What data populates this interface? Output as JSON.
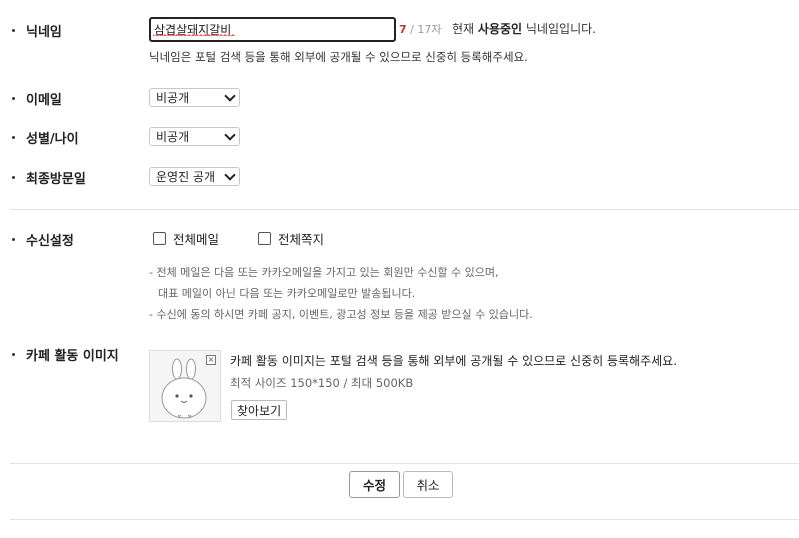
{
  "labels": {
    "nickname": "닉네임",
    "email": "이메일",
    "gender_age": "성별/나이",
    "last_visit": "최종방문일",
    "receive": "수신설정",
    "cafe_image": "카페 활동 이미지"
  },
  "nickname": {
    "value": "삼겹살돼지갈비",
    "count_current": "7",
    "count_max": "/ 17자",
    "current_prefix": "현재",
    "current_bold": "사용중인",
    "current_suffix": "닉네임입니다.",
    "help": "닉네임은 포털 검색 등을 통해 외부에 공개될 수 있으므로 신중히 등록해주세요."
  },
  "email": {
    "selected": "비공개"
  },
  "gender_age": {
    "selected": "비공개"
  },
  "last_visit": {
    "selected": "운영진 공개"
  },
  "receive": {
    "mail_label": "전체메일",
    "mail_checked": false,
    "note_label": "전체쪽지",
    "note_checked": false,
    "notes": [
      "- 전체 메일은 다음 또는 카카오메일을 가지고 있는 회원만 수신할 수 있으며,",
      "대표 메일이 아닌 다음 또는 카카오메일로만 발송됩니다.",
      "- 수신에 동의 하시면 카페 공지, 이벤트, 광고성 정보 등을 제공 받으실 수 있습니다."
    ]
  },
  "cafe_image": {
    "description": "카페 활동 이미지는 포털 검색 등을 통해 외부에 공개될 수 있으므로 신중히 등록해주세요.",
    "size_info": "최적 사이즈 150*150 / 최대 500KB",
    "find_button": "찾아보기",
    "remove_icon": "close-icon"
  },
  "buttons": {
    "submit": "수정",
    "cancel": "취소"
  }
}
